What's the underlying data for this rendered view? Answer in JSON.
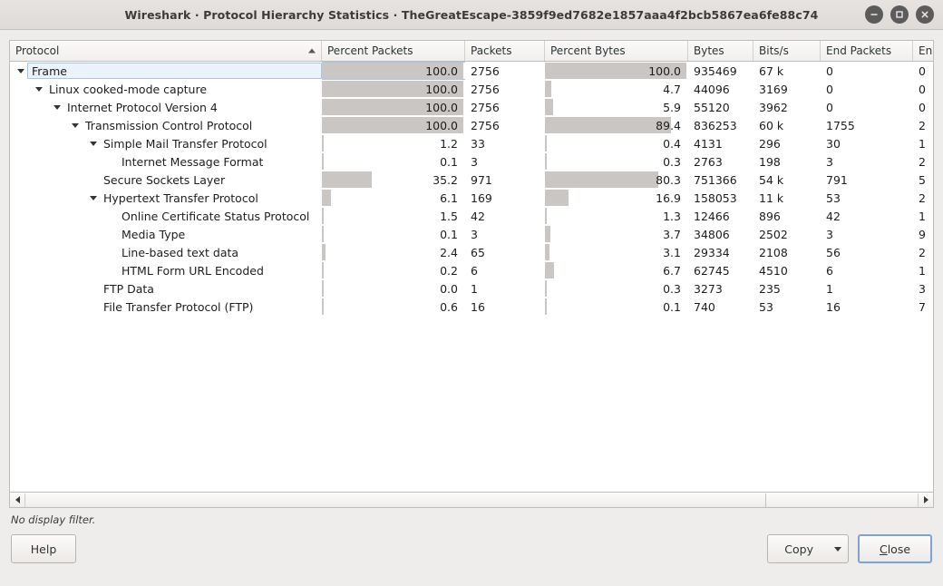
{
  "window": {
    "title": "Wireshark · Protocol Hierarchy Statistics · TheGreatEscape-3859f9ed7682e1857aaa4f2bcb5867ea6fe88c74",
    "minimize_label": "minimize-icon",
    "maximize_label": "maximize-icon",
    "close_label": "close-icon"
  },
  "table": {
    "columns": [
      {
        "label": "Protocol",
        "sorted": true,
        "sort_dir": "asc"
      },
      {
        "label": "Percent Packets",
        "sorted": false
      },
      {
        "label": "Packets",
        "sorted": false
      },
      {
        "label": "Percent Bytes",
        "sorted": false
      },
      {
        "label": "Bytes",
        "sorted": false
      },
      {
        "label": "Bits/s",
        "sorted": false
      },
      {
        "label": "End Packets",
        "sorted": false
      },
      {
        "label": "En",
        "sorted": false
      }
    ],
    "rows": [
      {
        "protocol": "Frame",
        "depth": 0,
        "expander": "expanded",
        "selected": true,
        "percent_packets": "100.0",
        "percent_packets_value": 100.0,
        "packets": "2756",
        "percent_bytes": "100.0",
        "percent_bytes_value": 100.0,
        "bytes": "935469",
        "bits_s": "67 k",
        "end_packets": "0",
        "end_bytes": "0"
      },
      {
        "protocol": "Linux cooked-mode capture",
        "depth": 1,
        "expander": "expanded",
        "selected": false,
        "percent_packets": "100.0",
        "percent_packets_value": 100.0,
        "packets": "2756",
        "percent_bytes": "4.7",
        "percent_bytes_value": 4.7,
        "bytes": "44096",
        "bits_s": "3169",
        "end_packets": "0",
        "end_bytes": "0"
      },
      {
        "protocol": "Internet Protocol Version 4",
        "depth": 2,
        "expander": "expanded",
        "selected": false,
        "percent_packets": "100.0",
        "percent_packets_value": 100.0,
        "packets": "2756",
        "percent_bytes": "5.9",
        "percent_bytes_value": 5.9,
        "bytes": "55120",
        "bits_s": "3962",
        "end_packets": "0",
        "end_bytes": "0"
      },
      {
        "protocol": "Transmission Control Protocol",
        "depth": 3,
        "expander": "expanded",
        "selected": false,
        "percent_packets": "100.0",
        "percent_packets_value": 100.0,
        "packets": "2756",
        "percent_bytes": "89.4",
        "percent_bytes_value": 89.4,
        "bytes": "836253",
        "bits_s": "60 k",
        "end_packets": "1755",
        "end_bytes": "2"
      },
      {
        "protocol": "Simple Mail Transfer Protocol",
        "depth": 4,
        "expander": "expanded",
        "selected": false,
        "percent_packets": "1.2",
        "percent_packets_value": 1.2,
        "packets": "33",
        "percent_bytes": "0.4",
        "percent_bytes_value": 0.4,
        "bytes": "4131",
        "bits_s": "296",
        "end_packets": "30",
        "end_bytes": "1"
      },
      {
        "protocol": "Internet Message Format",
        "depth": 5,
        "expander": "none",
        "selected": false,
        "percent_packets": "0.1",
        "percent_packets_value": 0.1,
        "packets": "3",
        "percent_bytes": "0.3",
        "percent_bytes_value": 0.3,
        "bytes": "2763",
        "bits_s": "198",
        "end_packets": "3",
        "end_bytes": "2"
      },
      {
        "protocol": "Secure Sockets Layer",
        "depth": 4,
        "expander": "none",
        "selected": false,
        "percent_packets": "35.2",
        "percent_packets_value": 35.2,
        "packets": "971",
        "percent_bytes": "80.3",
        "percent_bytes_value": 80.3,
        "bytes": "751366",
        "bits_s": "54 k",
        "end_packets": "791",
        "end_bytes": "5"
      },
      {
        "protocol": "Hypertext Transfer Protocol",
        "depth": 4,
        "expander": "expanded",
        "selected": false,
        "percent_packets": "6.1",
        "percent_packets_value": 6.1,
        "packets": "169",
        "percent_bytes": "16.9",
        "percent_bytes_value": 16.9,
        "bytes": "158053",
        "bits_s": "11 k",
        "end_packets": "53",
        "end_bytes": "2"
      },
      {
        "protocol": "Online Certificate Status Protocol",
        "depth": 5,
        "expander": "none",
        "selected": false,
        "percent_packets": "1.5",
        "percent_packets_value": 1.5,
        "packets": "42",
        "percent_bytes": "1.3",
        "percent_bytes_value": 1.3,
        "bytes": "12466",
        "bits_s": "896",
        "end_packets": "42",
        "end_bytes": "1"
      },
      {
        "protocol": "Media Type",
        "depth": 5,
        "expander": "none",
        "selected": false,
        "percent_packets": "0.1",
        "percent_packets_value": 0.1,
        "packets": "3",
        "percent_bytes": "3.7",
        "percent_bytes_value": 3.7,
        "bytes": "34806",
        "bits_s": "2502",
        "end_packets": "3",
        "end_bytes": "9"
      },
      {
        "protocol": "Line-based text data",
        "depth": 5,
        "expander": "none",
        "selected": false,
        "percent_packets": "2.4",
        "percent_packets_value": 2.4,
        "packets": "65",
        "percent_bytes": "3.1",
        "percent_bytes_value": 3.1,
        "bytes": "29334",
        "bits_s": "2108",
        "end_packets": "56",
        "end_bytes": "2"
      },
      {
        "protocol": "HTML Form URL Encoded",
        "depth": 5,
        "expander": "none",
        "selected": false,
        "percent_packets": "0.2",
        "percent_packets_value": 0.2,
        "packets": "6",
        "percent_bytes": "6.7",
        "percent_bytes_value": 6.7,
        "bytes": "62745",
        "bits_s": "4510",
        "end_packets": "6",
        "end_bytes": "1"
      },
      {
        "protocol": "FTP Data",
        "depth": 4,
        "expander": "none",
        "selected": false,
        "percent_packets": "0.0",
        "percent_packets_value": 0.02,
        "packets": "1",
        "percent_bytes": "0.3",
        "percent_bytes_value": 0.3,
        "bytes": "3273",
        "bits_s": "235",
        "end_packets": "1",
        "end_bytes": "3"
      },
      {
        "protocol": "File Transfer Protocol (FTP)",
        "depth": 4,
        "expander": "none",
        "selected": false,
        "percent_packets": "0.6",
        "percent_packets_value": 0.6,
        "packets": "16",
        "percent_bytes": "0.1",
        "percent_bytes_value": 0.1,
        "bytes": "740",
        "bits_s": "53",
        "end_packets": "16",
        "end_bytes": "7"
      }
    ]
  },
  "status": {
    "display_filter": "No display filter."
  },
  "footer": {
    "help_label": "Help",
    "copy_label": "Copy",
    "close_label": "Close",
    "close_mnemonic": "C",
    "close_rest": "lose"
  },
  "colors": {
    "bar": "#c9c6c3",
    "selection_border": "#a9c6e8",
    "selection_fill": "#eaf2fb",
    "default_button_border": "#7ba4d0"
  }
}
